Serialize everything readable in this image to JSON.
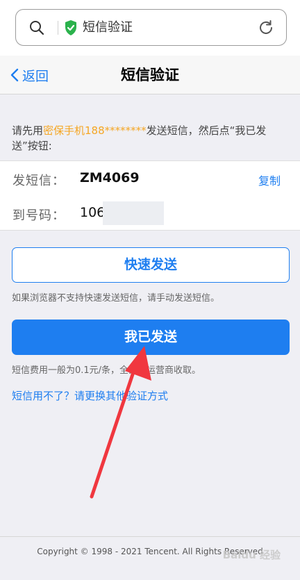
{
  "browser": {
    "address_title": "短信验证"
  },
  "header": {
    "back_label": "返回",
    "title": "短信验证"
  },
  "instruction": {
    "prefix": "请先用",
    "highlight": "密保手机188********",
    "suffix": "发送短信，然后点“我已发送”按钮:"
  },
  "sms": {
    "send_label": "发短信：",
    "send_code": "ZM4069",
    "copy_label": "复制",
    "to_label": "到号码：",
    "to_number_visible": "106"
  },
  "actions": {
    "fast_send_label": "快速发送",
    "fast_send_note": "如果浏览器不支持快速发送短信，请手动发送短信。",
    "sent_label": "我已发送",
    "fee_note": "短信费用一般为0.1元/条，全部由运营商收取。",
    "alt_link": "短信用不了？请更换其他验证方式"
  },
  "footer": {
    "copyright": "Copyright © 1998 - 2021 Tencent. All Rights Reserved"
  },
  "watermark": "Baidu 经验",
  "colors": {
    "accent": "#1e7ef0",
    "highlight": "#f5a623",
    "shield": "#2bb24c",
    "arrow": "#f0373f"
  }
}
